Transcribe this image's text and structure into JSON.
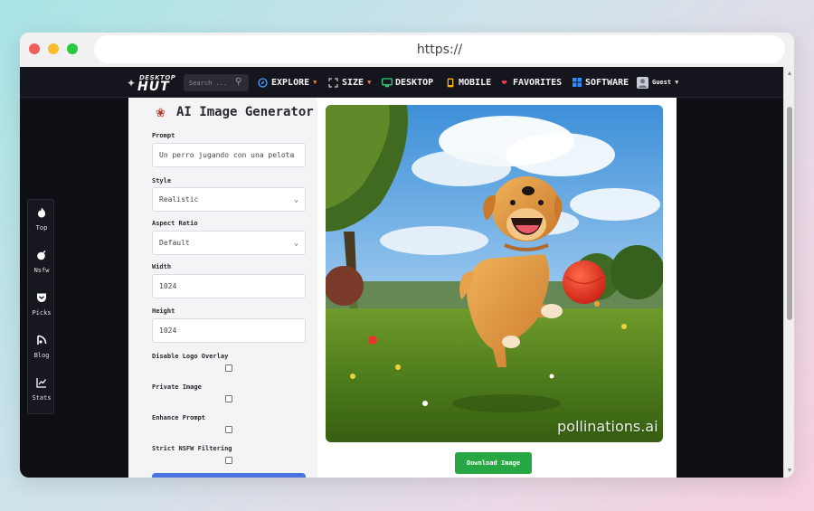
{
  "browser": {
    "url": "https://"
  },
  "navbar": {
    "logo": {
      "top_text": "DESKTOP",
      "main_text": "HUT"
    },
    "search": {
      "placeholder": "Search ..."
    },
    "items": [
      {
        "label": "EXPLORE",
        "icon": "compass-icon",
        "has_dropdown": true
      },
      {
        "label": "SIZE",
        "icon": "resize-icon",
        "has_dropdown": true
      },
      {
        "label": "DESKTOP",
        "icon": "monitor-icon",
        "has_dropdown": false
      },
      {
        "label": "MOBILE",
        "icon": "smartphone-icon",
        "has_dropdown": false
      },
      {
        "label": "FAVORITES",
        "icon": "heart-icon",
        "has_dropdown": false
      },
      {
        "label": "SOFTWARE",
        "icon": "windows-icon",
        "has_dropdown": false
      }
    ],
    "user": {
      "label": "Guest",
      "icon": "user-avatar-icon"
    }
  },
  "sidebar": {
    "items": [
      {
        "label": "Top",
        "icon": "flame-icon"
      },
      {
        "label": "Nsfw",
        "icon": "bomb-icon"
      },
      {
        "label": "Picks",
        "icon": "pocket-icon"
      },
      {
        "label": "Blog",
        "icon": "blog-icon"
      },
      {
        "label": "Stats",
        "icon": "chart-line-icon"
      }
    ]
  },
  "generator": {
    "title": "AI Image Generator",
    "prompt": {
      "label": "Prompt",
      "value": "Un perro jugando con una pelota"
    },
    "style": {
      "label": "Style",
      "value": "Realistic"
    },
    "aspect_ratio": {
      "label": "Aspect Ratio",
      "value": "Default"
    },
    "width": {
      "label": "Width",
      "value": "1024"
    },
    "height": {
      "label": "Height",
      "value": "1024"
    },
    "options": [
      {
        "label": "Disable Logo Overlay",
        "checked": false
      },
      {
        "label": "Private Image",
        "checked": false
      },
      {
        "label": "Enhance Prompt",
        "checked": false
      },
      {
        "label": "Strict NSFW Filtering",
        "checked": false
      }
    ]
  },
  "result": {
    "watermark": "pollinations.ai",
    "download_label": "Download Image"
  },
  "colors": {
    "nav_bg": "#15161d",
    "caret": "#ff7a1a",
    "download_green": "#28a745",
    "generate_blue": "#4a72e0"
  }
}
